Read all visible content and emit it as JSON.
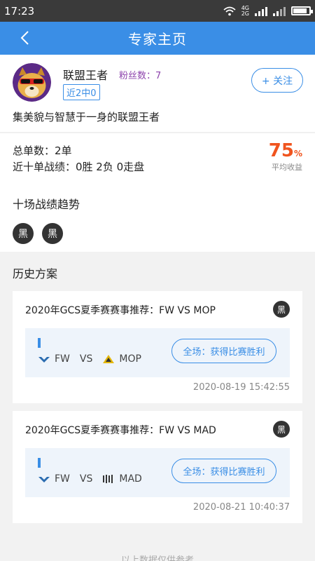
{
  "status_bar": {
    "time": "17:23",
    "net_top": "4G",
    "net_bottom": "2G"
  },
  "header": {
    "title": "专家主页"
  },
  "profile": {
    "name": "联盟王者",
    "fans_label": "粉丝数：7",
    "record_badge": "近2中0",
    "follow_label": "+ 关注",
    "motto": "集美貌与智慧于一身的联盟王者"
  },
  "stats": {
    "total_orders": "总单数：2单",
    "recent_record": "近十单战绩：0胜 2负 0走盘",
    "yield_value": "75",
    "yield_unit": "%",
    "yield_label": "平均收益"
  },
  "trend": {
    "title": "十场战绩趋势",
    "results": [
      "黑",
      "黑"
    ]
  },
  "history": {
    "title": "历史方案",
    "cards": [
      {
        "title": "2020年GCS夏季赛赛事推荐：FW VS MOP",
        "badge": "黑",
        "team_a": "FW",
        "vs": "VS",
        "team_b": "MOP",
        "pick": "全场：获得比赛胜利",
        "time": "2020-08-19 15:42:55"
      },
      {
        "title": "2020年GCS夏季赛赛事推荐：FW VS MAD",
        "badge": "黑",
        "team_a": "FW",
        "vs": "VS",
        "team_b": "MAD",
        "pick": "全场：获得比赛胜利",
        "time": "2020-08-21 10:40:37"
      }
    ]
  },
  "footer": {
    "note": "以上数据仅供参考"
  },
  "colors": {
    "primary": "#3a8ee6",
    "accent": "#f0541e",
    "fans": "#8e44ad",
    "dark_badge": "#333333"
  }
}
